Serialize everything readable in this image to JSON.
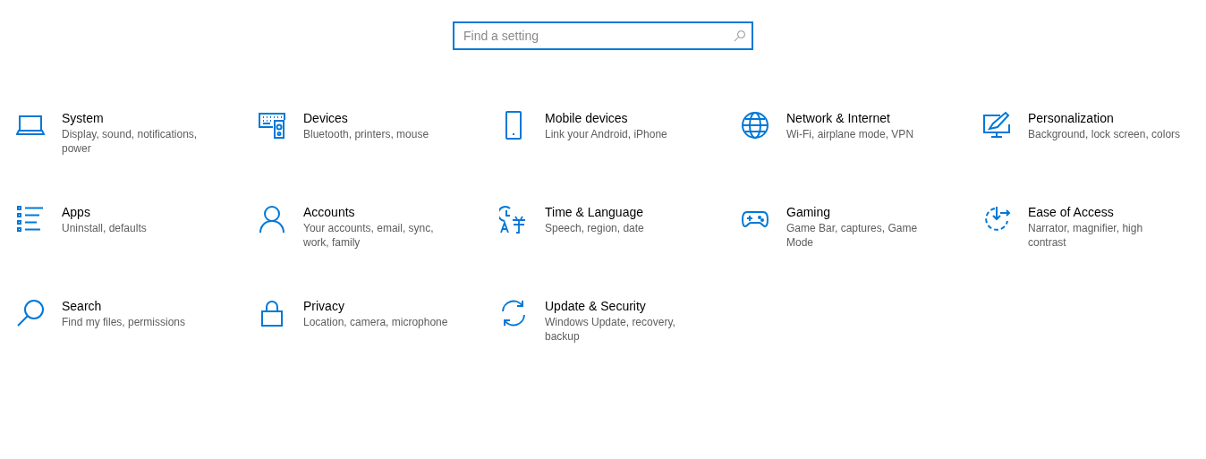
{
  "search": {
    "placeholder": "Find a setting"
  },
  "categories": [
    {
      "title": "System",
      "description": "Display, sound, notifications, power"
    },
    {
      "title": "Devices",
      "description": "Bluetooth, printers, mouse"
    },
    {
      "title": "Mobile devices",
      "description": "Link your Android, iPhone"
    },
    {
      "title": "Network & Internet",
      "description": "Wi-Fi, airplane mode, VPN"
    },
    {
      "title": "Personalization",
      "description": "Background, lock screen, colors"
    },
    {
      "title": "Apps",
      "description": "Uninstall, defaults"
    },
    {
      "title": "Accounts",
      "description": "Your accounts, email, sync, work, family"
    },
    {
      "title": "Time & Language",
      "description": "Speech, region, date"
    },
    {
      "title": "Gaming",
      "description": "Game Bar, captures, Game Mode"
    },
    {
      "title": "Ease of Access",
      "description": "Narrator, magnifier, high contrast"
    },
    {
      "title": "Search",
      "description": "Find my files, permissions"
    },
    {
      "title": "Privacy",
      "description": "Location, camera, microphone"
    },
    {
      "title": "Update & Security",
      "description": "Windows Update, recovery, backup"
    }
  ]
}
